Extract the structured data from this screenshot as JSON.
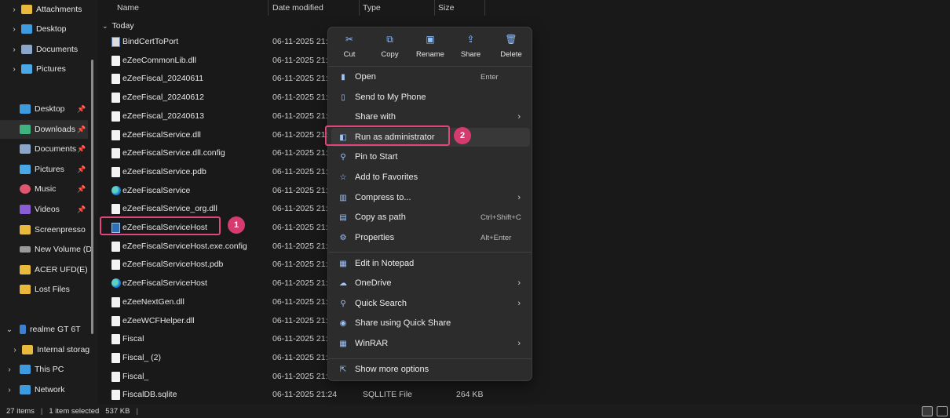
{
  "sidebar": {
    "top_items": [
      {
        "label": "Attachments",
        "icon": "folder-icon"
      },
      {
        "label": "Desktop",
        "icon": "desktop-icon"
      },
      {
        "label": "Documents",
        "icon": "documents-icon"
      },
      {
        "label": "Pictures",
        "icon": "pictures-icon"
      }
    ],
    "quick_access": [
      {
        "label": "Desktop",
        "icon": "desktop-icon",
        "pinned": true
      },
      {
        "label": "Downloads",
        "icon": "downloads-icon",
        "pinned": true
      },
      {
        "label": "Documents",
        "icon": "documents-icon",
        "pinned": true
      },
      {
        "label": "Pictures",
        "icon": "pictures-icon",
        "pinned": true
      },
      {
        "label": "Music",
        "icon": "music-icon",
        "pinned": true
      },
      {
        "label": "Videos",
        "icon": "videos-icon",
        "pinned": true
      },
      {
        "label": "Screenpresso",
        "icon": "folder-icon"
      },
      {
        "label": "New Volume (D:",
        "icon": "drive-icon"
      },
      {
        "label": "ACER UFD(E)",
        "icon": "folder-icon"
      },
      {
        "label": "Lost Files",
        "icon": "folder-icon"
      }
    ],
    "devices": [
      {
        "label": "realme GT 6T",
        "icon": "phone-icon"
      },
      {
        "label": "Internal storag",
        "icon": "folder-icon"
      },
      {
        "label": "This PC",
        "icon": "pc-icon"
      },
      {
        "label": "Network",
        "icon": "network-icon"
      }
    ]
  },
  "columns": {
    "name": "Name",
    "date": "Date modified",
    "type": "Type",
    "size": "Size"
  },
  "group": {
    "label": "Today"
  },
  "files": [
    {
      "name": "BindCertToPort",
      "date": "06-11-2025 21:24",
      "type": "",
      "size": "",
      "icon": "exe"
    },
    {
      "name": "eZeeCommonLib.dll",
      "date": "06-11-2025 21:24",
      "type": "",
      "size": "",
      "icon": "doc"
    },
    {
      "name": "eZeeFiscal_20240611",
      "date": "06-11-2025 21:24",
      "type": "",
      "size": "",
      "icon": "doc"
    },
    {
      "name": "eZeeFiscal_20240612",
      "date": "06-11-2025 21:24",
      "type": "",
      "size": "",
      "icon": "doc"
    },
    {
      "name": "eZeeFiscal_20240613",
      "date": "06-11-2025 21:24",
      "type": "",
      "size": "",
      "icon": "doc"
    },
    {
      "name": "eZeeFiscalService.dll",
      "date": "06-11-2025 21:24",
      "type": "",
      "size": "",
      "icon": "doc"
    },
    {
      "name": "eZeeFiscalService.dll.config",
      "date": "06-11-2025 21:24",
      "type": "",
      "size": "",
      "icon": "doc"
    },
    {
      "name": "eZeeFiscalService.pdb",
      "date": "06-11-2025 21:24",
      "type": "",
      "size": "",
      "icon": "doc"
    },
    {
      "name": "eZeeFiscalService",
      "date": "06-11-2025 21:24",
      "type": "",
      "size": "",
      "icon": "edge"
    },
    {
      "name": "eZeeFiscalService_org.dll",
      "date": "06-11-2025 21:24",
      "type": "",
      "size": "",
      "icon": "doc"
    },
    {
      "name": "eZeeFiscalServiceHost",
      "date": "06-11-2025 21:24",
      "type": "",
      "size": "",
      "icon": "appx"
    },
    {
      "name": "eZeeFiscalServiceHost.exe.config",
      "date": "06-11-2025 21:24",
      "type": "",
      "size": "",
      "icon": "doc"
    },
    {
      "name": "eZeeFiscalServiceHost.pdb",
      "date": "06-11-2025 21:24",
      "type": "",
      "size": "",
      "icon": "doc"
    },
    {
      "name": "eZeeFiscalServiceHost",
      "date": "06-11-2025 21:24",
      "type": "",
      "size": "",
      "icon": "edge"
    },
    {
      "name": "eZeeNextGen.dll",
      "date": "06-11-2025 21:24",
      "type": "",
      "size": "",
      "icon": "doc"
    },
    {
      "name": "eZeeWCFHelper.dll",
      "date": "06-11-2025 21:24",
      "type": "",
      "size": "",
      "icon": "doc"
    },
    {
      "name": "Fiscal",
      "date": "06-11-2025 21:24",
      "type": "",
      "size": "",
      "icon": "doc"
    },
    {
      "name": "Fiscal_ (2)",
      "date": "06-11-2025 21:24",
      "type": "",
      "size": "",
      "icon": "doc"
    },
    {
      "name": "Fiscal_",
      "date": "06-11-2025 21:24",
      "type": "",
      "size": "",
      "icon": "doc"
    },
    {
      "name": "FiscalDB.sqlite",
      "date": "06-11-2025 21:24",
      "type": "SQLLITE File",
      "size": "264 KB",
      "icon": "doc"
    }
  ],
  "callouts": {
    "step1": "1",
    "step2": "2"
  },
  "context_menu": {
    "quick_actions": [
      {
        "label": "Cut",
        "icon": "cut-icon",
        "glyph": "✂"
      },
      {
        "label": "Copy",
        "icon": "copy-icon",
        "glyph": "⧉"
      },
      {
        "label": "Rename",
        "icon": "rename-icon",
        "glyph": "▣"
      },
      {
        "label": "Share",
        "icon": "share-icon",
        "glyph": "⇪"
      },
      {
        "label": "Delete",
        "icon": "delete-icon",
        "glyph": "🗑"
      }
    ],
    "items": [
      {
        "label": "Open",
        "shortcut": "Enter",
        "submenu": false,
        "icon": "open-icon",
        "glyph": "▮"
      },
      {
        "label": "Send to My Phone",
        "shortcut": "",
        "submenu": false,
        "icon": "phone-icon",
        "glyph": "▯"
      },
      {
        "label": "Share with",
        "shortcut": "",
        "submenu": true,
        "icon": "share-with-icon",
        "glyph": ""
      },
      {
        "label": "Run as administrator",
        "shortcut": "",
        "submenu": false,
        "icon": "shield-icon",
        "glyph": "◧"
      },
      {
        "label": "Pin to Start",
        "shortcut": "",
        "submenu": false,
        "icon": "pin-icon",
        "glyph": "⚲"
      },
      {
        "label": "Add to Favorites",
        "shortcut": "",
        "submenu": false,
        "icon": "star-icon",
        "glyph": "☆"
      },
      {
        "label": "Compress to...",
        "shortcut": "",
        "submenu": true,
        "icon": "zip-icon",
        "glyph": "▥"
      },
      {
        "label": "Copy as path",
        "shortcut": "Ctrl+Shift+C",
        "submenu": false,
        "icon": "path-icon",
        "glyph": "▤"
      },
      {
        "label": "Properties",
        "shortcut": "Alt+Enter",
        "submenu": false,
        "icon": "wrench-icon",
        "glyph": "⚙"
      },
      {
        "label": "Edit in Notepad",
        "shortcut": "",
        "submenu": false,
        "icon": "notepad-icon",
        "glyph": "▦"
      },
      {
        "label": "OneDrive",
        "shortcut": "",
        "submenu": true,
        "icon": "onedrive-icon",
        "glyph": "☁"
      },
      {
        "label": "Quick Search",
        "shortcut": "",
        "submenu": true,
        "icon": "search-icon",
        "glyph": "⚲"
      },
      {
        "label": "Share using Quick Share",
        "shortcut": "",
        "submenu": false,
        "icon": "quickshare-icon",
        "glyph": "◉"
      },
      {
        "label": "WinRAR",
        "shortcut": "",
        "submenu": true,
        "icon": "winrar-icon",
        "glyph": "▦"
      },
      {
        "label": "Show more options",
        "shortcut": "",
        "submenu": false,
        "icon": "more-options-icon",
        "glyph": "⇱"
      }
    ]
  },
  "status": {
    "item_count": "27 items",
    "selected": "1 item selected",
    "size": "537 KB"
  },
  "colors": {
    "highlight": "#e0457b",
    "badge": "#d63b70"
  }
}
